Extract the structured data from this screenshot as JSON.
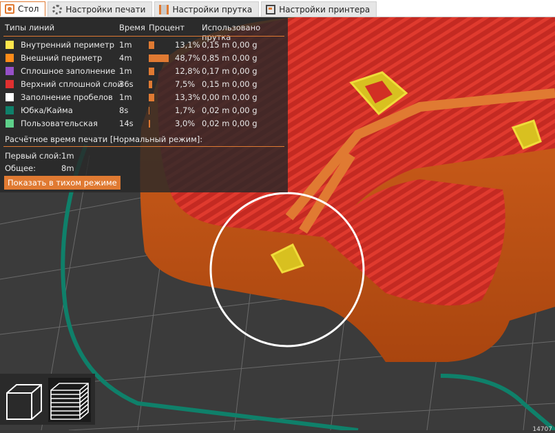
{
  "tabs": [
    {
      "label": "Стол",
      "icon": "bed-icon",
      "active": true
    },
    {
      "label": "Настройки печати",
      "icon": "gear-icon",
      "active": false
    },
    {
      "label": "Настройки прутка",
      "icon": "spool-icon",
      "active": false
    },
    {
      "label": "Настройки принтера",
      "icon": "printer-icon",
      "active": false
    }
  ],
  "legend": {
    "headers": {
      "types": "Типы линий",
      "time": "Время",
      "percent": "Процент",
      "used": "Использовано прутка"
    },
    "rows": [
      {
        "name": "Внутренний периметр",
        "time": "1m",
        "percent": "13,1%",
        "share": 13.1,
        "meters": "0,15 m",
        "grams": "0,00 g",
        "color": "#ffe64c"
      },
      {
        "name": "Внешний периметр",
        "time": "4m",
        "percent": "48,7%",
        "share": 48.7,
        "meters": "0,85 m",
        "grams": "0,00 g",
        "color": "#ff8c1a"
      },
      {
        "name": "Сплошное заполнение",
        "time": "1m",
        "percent": "12,8%",
        "share": 12.8,
        "meters": "0,17 m",
        "grams": "0,00 g",
        "color": "#9650c8"
      },
      {
        "name": "Верхний сплошной слой",
        "time": "36s",
        "percent": "7,5%",
        "share": 7.5,
        "meters": "0,15 m",
        "grams": "0,00 g",
        "color": "#e03030"
      },
      {
        "name": "Заполнение пробелов",
        "time": "1m",
        "percent": "13,3%",
        "share": 13.3,
        "meters": "0,00 m",
        "grams": "0,00 g",
        "color": "#ffffff"
      },
      {
        "name": "Юбка/Кайма",
        "time": "8s",
        "percent": "1,7%",
        "share": 1.7,
        "meters": "0,02 m",
        "grams": "0,00 g",
        "color": "#0f806a"
      },
      {
        "name": "Пользовательская",
        "time": "14s",
        "percent": "3,0%",
        "share": 3.0,
        "meters": "0,02 m",
        "grams": "0,00 g",
        "color": "#5ed08a"
      }
    ],
    "estimate_title": "Расчётное время печати [Нормальный режим]:",
    "first_layer_label": "Первый слой:",
    "first_layer_value": "1m",
    "total_label": "Общее:",
    "total_value": "8m",
    "silent_button": "Показать в тихом режиме"
  },
  "colors": {
    "accent": "#e07a32",
    "bed": "#3a3a3a",
    "plastic": "#c8581a",
    "skirt": "#0f806a"
  },
  "view_buttons": [
    {
      "icon": "iso-cube-icon",
      "active": false
    },
    {
      "icon": "layers-view-icon",
      "active": true
    }
  ],
  "corner_counter": "14707"
}
